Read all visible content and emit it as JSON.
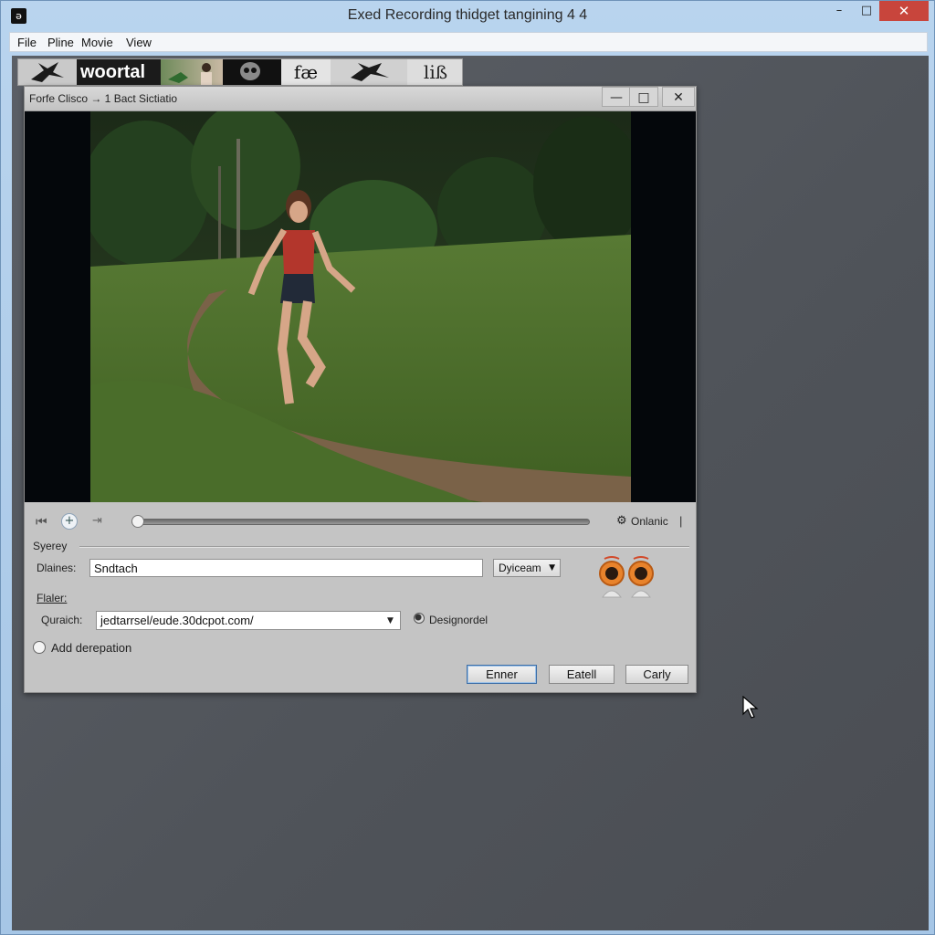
{
  "app": {
    "title": "Exed Recording thidget tangining 4 4",
    "icon_char": "ə",
    "controls": {
      "minimize": "–",
      "maximize": "□",
      "close": "✕"
    }
  },
  "menu": {
    "items": [
      "File",
      "Pline",
      "Movie",
      "View"
    ]
  },
  "banner": {
    "logo_text": "woortal",
    "tile_text_1": "fæ",
    "tile_text_2": "liß"
  },
  "dialog": {
    "title": "Forfe Clisco → 1 Bact Sictiatio",
    "controls": {
      "minimize": "—",
      "maximize": "□",
      "close": "✕"
    },
    "player": {
      "skip_icon": "skip-back-icon",
      "online_label": "Onlanic",
      "separator": "|",
      "seek_progress": 0.0
    },
    "section_label": "Syerey",
    "fields": {
      "name_label": "Dlaines:",
      "name_value": "Sndtach",
      "stream_select": "Dyiceam",
      "folder_label": "Flaler:",
      "url_label": "Quraich:",
      "url_value": "jedtarrsel/eude.30dcpot.com/",
      "designer_label": "Designordel",
      "add_label": "Add derepation"
    },
    "buttons": {
      "enter": "Enner",
      "cancel": "Eatell",
      "copy": "Carly"
    }
  },
  "colors": {
    "titlebar": "#b9d4ee",
    "close_button": "#c8453c",
    "workspace": "#52565c",
    "dialog": "#c4c4c4",
    "accent_orange": "#e8832c"
  }
}
